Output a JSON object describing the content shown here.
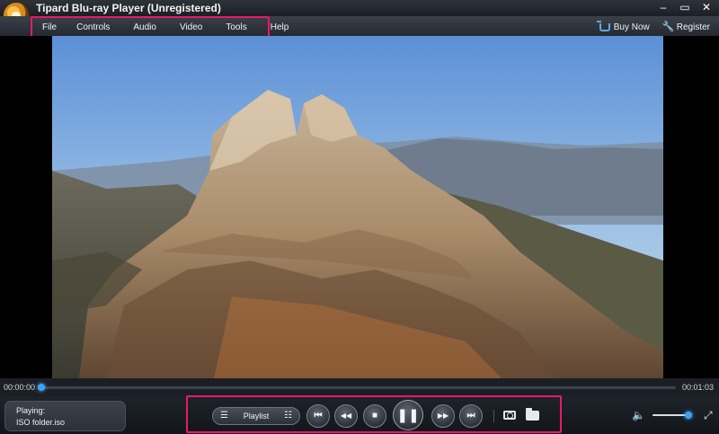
{
  "window": {
    "title": "Tipard Blu-ray Player (Unregistered)",
    "controls": {
      "minimize": "–",
      "maximize": "▭",
      "close": "✕"
    }
  },
  "menu": {
    "items": [
      "File",
      "Controls",
      "Audio",
      "Video",
      "Tools",
      "Help"
    ],
    "buy_now": "Buy Now",
    "register": "Register"
  },
  "colors": {
    "accent": "#2f8ce0",
    "highlight": "#e8196a",
    "background": "#0d1014"
  },
  "seek": {
    "current_time": "00:00:00",
    "duration": "00:01:03",
    "progress": 0.0
  },
  "status": {
    "label": "Playing:",
    "file": "ISO folder.iso"
  },
  "controls": {
    "playlist_label": "Playlist",
    "buttons": [
      "previous-icon",
      "rewind-icon",
      "stop-icon",
      "pause-icon",
      "fast-forward-icon",
      "next-icon"
    ],
    "extra_icons": [
      "camera-icon",
      "folder-open-icon"
    ],
    "volume_level": 0.9
  },
  "icons": {
    "previous": "⏮",
    "rewind": "◀◀",
    "stop": "■",
    "pause": "❚❚",
    "fast_forward": "▶▶",
    "next": "⏭",
    "volume": "🔈",
    "fullscreen": "⤢",
    "wrench": "🔧",
    "playlist_left": "☰",
    "playlist_right": "☷"
  }
}
